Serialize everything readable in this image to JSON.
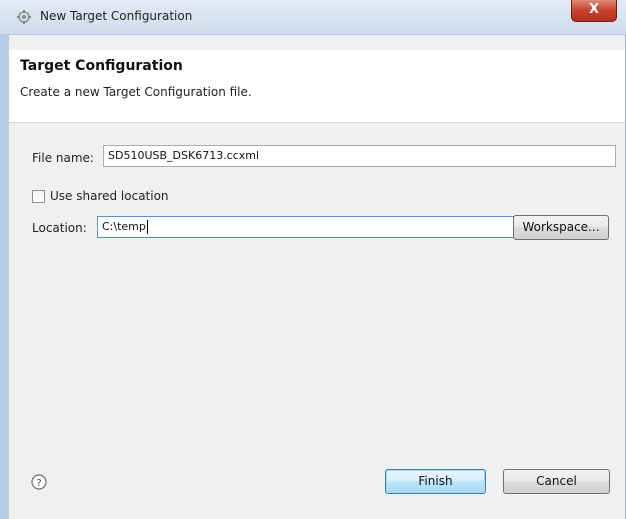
{
  "window": {
    "title": "New Target Configuration",
    "close_glyph": "X"
  },
  "banner": {
    "title": "Target Configuration",
    "description": "Create a new Target Configuration file."
  },
  "form": {
    "file_name_label": "File name:",
    "file_name_value": "SD510USB_DSK6713.ccxml",
    "use_shared_label": "Use shared location",
    "use_shared_checked": false,
    "location_label": "Location:",
    "location_value": "C:\\temp",
    "workspace_button": "Workspace..."
  },
  "footer": {
    "help_icon": "help-icon",
    "finish_button": "Finish",
    "cancel_button": "Cancel"
  },
  "colors": {
    "accent_border": "#3c7fb1",
    "close_red": "#c8412d"
  }
}
